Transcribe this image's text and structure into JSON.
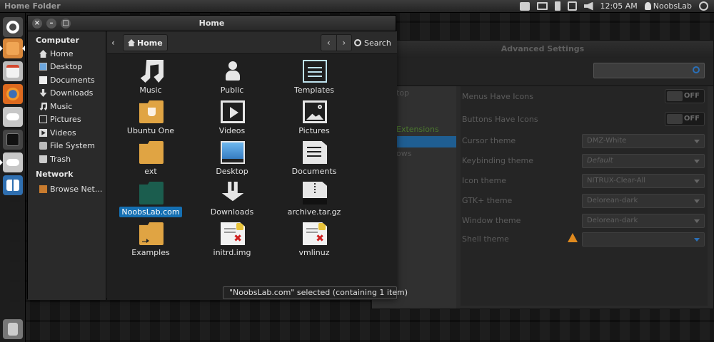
{
  "top_panel": {
    "title": "Home Folder",
    "clock": "12:05 AM",
    "user": "NoobsLab",
    "indicators": [
      "printer-icon",
      "mail-icon",
      "battery-icon",
      "network-icon",
      "volume-icon",
      "power-icon"
    ]
  },
  "launcher": {
    "items": [
      "ubuntu-dash-icon",
      "files-icon",
      "notes-icon",
      "firefox-icon",
      "drive-icon",
      "terminal-icon",
      "drive-icon",
      "workspace-switcher-icon",
      "trash-icon"
    ]
  },
  "file_manager": {
    "title": "Home",
    "breadcrumb": "Home",
    "search_label": "Search",
    "back_glyph": "‹",
    "prev_glyph": "‹",
    "next_glyph": "›",
    "sidebar": {
      "computer_header": "Computer",
      "network_header": "Network",
      "items": [
        {
          "label": "Home",
          "icon": "home-icon"
        },
        {
          "label": "Desktop",
          "icon": "desktop-icon"
        },
        {
          "label": "Documents",
          "icon": "documents-icon"
        },
        {
          "label": "Downloads",
          "icon": "downloads-icon"
        },
        {
          "label": "Music",
          "icon": "music-icon"
        },
        {
          "label": "Pictures",
          "icon": "pictures-icon"
        },
        {
          "label": "Videos",
          "icon": "videos-icon"
        },
        {
          "label": "File System",
          "icon": "file-system-icon"
        },
        {
          "label": "Trash",
          "icon": "trash-icon"
        }
      ],
      "network_items": [
        {
          "label": "Browse Net...",
          "icon": "browse-network-icon"
        }
      ]
    },
    "files": [
      {
        "label": "Music",
        "icon": "music-note-icon"
      },
      {
        "label": "Public",
        "icon": "person-icon"
      },
      {
        "label": "Templates",
        "icon": "template-icon"
      },
      {
        "label": "Ubuntu One",
        "icon": "ubuntu-one-folder-icon"
      },
      {
        "label": "Videos",
        "icon": "video-icon"
      },
      {
        "label": "Pictures",
        "icon": "picture-icon"
      },
      {
        "label": "ext",
        "icon": "folder-icon"
      },
      {
        "label": "Desktop",
        "icon": "desktop-icon"
      },
      {
        "label": "Documents",
        "icon": "document-icon"
      },
      {
        "label": "NoobsLab.com",
        "icon": "folder-icon",
        "selected": true
      },
      {
        "label": "Downloads",
        "icon": "download-icon"
      },
      {
        "label": "archive.tar.gz",
        "icon": "archive-icon"
      },
      {
        "label": "Examples",
        "icon": "folder-link-icon"
      },
      {
        "label": "initrd.img",
        "icon": "binary-icon"
      },
      {
        "label": "vmlinuz",
        "icon": "binary-icon"
      }
    ],
    "status": "\"NoobsLab.com\" selected (containing 1 item)"
  },
  "advanced_settings": {
    "title": "Advanced Settings",
    "sidebar_items": [
      "top",
      "Extensions",
      "ows"
    ],
    "rows": [
      {
        "label": "Menus Have Icons",
        "type": "toggle",
        "value": "OFF"
      },
      {
        "label": "Buttons Have Icons",
        "type": "toggle",
        "value": "OFF"
      },
      {
        "label": "Cursor theme",
        "type": "combo",
        "value": "DMZ-White"
      },
      {
        "label": "Keybinding theme",
        "type": "combo",
        "value": "Default"
      },
      {
        "label": "Icon theme",
        "type": "combo",
        "value": "NITRUX-Clear-All"
      },
      {
        "label": "GTK+ theme",
        "type": "combo",
        "value": "Delorean-dark"
      },
      {
        "label": "Window theme",
        "type": "combo",
        "value": "Delorean-dark"
      },
      {
        "label": "Shell theme",
        "type": "combo",
        "value": ""
      }
    ]
  },
  "colors": {
    "selection": "#1570b3",
    "folder": "#e0a443",
    "warning": "#e08a1e"
  }
}
